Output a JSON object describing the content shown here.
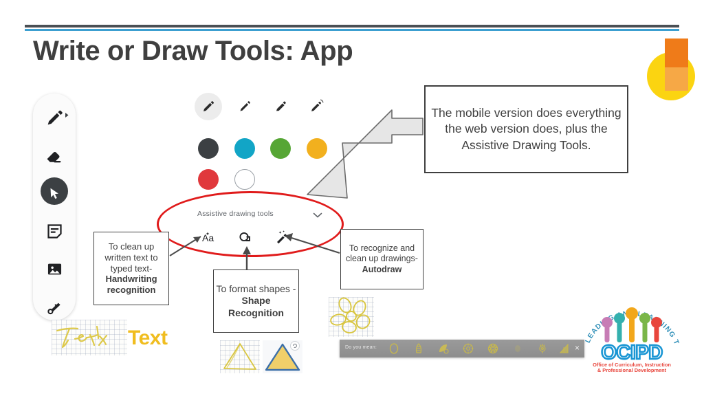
{
  "slide": {
    "title": "Write or Draw Tools: App",
    "accent_blue": "#3c9fd0",
    "accent_dark": "#4a4f54",
    "highlight_red": "#e01b1b"
  },
  "decor": {
    "circle_color": "#fbd411",
    "rect_top_color": "#ef7b19",
    "rect_bottom_color": "#f6a846"
  },
  "toolbar": {
    "items": [
      {
        "name": "pen-tool",
        "label": "Pen",
        "selected": false
      },
      {
        "name": "eraser-tool",
        "label": "Eraser",
        "selected": false
      },
      {
        "name": "select-tool",
        "label": "Select",
        "selected": true
      },
      {
        "name": "sticky-note-tool",
        "label": "Sticky note",
        "selected": false
      },
      {
        "name": "image-tool",
        "label": "Image",
        "selected": false
      },
      {
        "name": "laser-pointer-tool",
        "label": "Laser pointer",
        "selected": false
      }
    ]
  },
  "pens": {
    "items": [
      {
        "name": "pen",
        "label": "Pen",
        "selected": true
      },
      {
        "name": "marker",
        "label": "Marker",
        "selected": false
      },
      {
        "name": "highlighter",
        "label": "Highlighter",
        "selected": false
      },
      {
        "name": "thin-pen",
        "label": "Thin pen",
        "selected": false
      }
    ]
  },
  "colors": {
    "row1": [
      {
        "name": "color-black",
        "label": "Black",
        "hex": "#3c4043",
        "selected": true
      },
      {
        "name": "color-cyan",
        "label": "Cyan",
        "hex": "#12a5c6",
        "selected": false
      },
      {
        "name": "color-green",
        "label": "Green",
        "hex": "#56a635",
        "selected": false
      },
      {
        "name": "color-yellow",
        "label": "Yellow",
        "hex": "#f2b01e",
        "selected": false
      }
    ],
    "row2": [
      {
        "name": "color-red",
        "label": "Red",
        "hex": "#e0383c",
        "selected": false
      },
      {
        "name": "color-white",
        "label": "White",
        "hex": "#ffffff",
        "selected": false
      }
    ]
  },
  "assistive": {
    "panel_label": "Assistive drawing tools",
    "chevron": "chevron-down-icon",
    "tools": [
      {
        "name": "handwriting-recognition-icon",
        "label": "Aa"
      },
      {
        "name": "shape-recognition-icon",
        "label": "Shape"
      },
      {
        "name": "autodraw-icon",
        "label": "Autodraw"
      }
    ]
  },
  "callout": {
    "text": "The mobile version does everything the web version does, plus the Assistive Drawing Tools."
  },
  "notes": {
    "handwriting": {
      "lead": "To clean up written text to typed text-",
      "bold": "Handwriting recognition"
    },
    "shape": {
      "lead": "To format shapes -",
      "bold": "Shape Recognition"
    },
    "autodraw": {
      "lead": "To recognize and clean up drawings-",
      "bold": "Autodraw"
    }
  },
  "demos": {
    "handwritten_text": "Text",
    "typed_text": "Text",
    "ink_color": "#ddc94a",
    "typed_color": "#f0bd1f"
  },
  "suggest_bar": {
    "label": "Do you mean:",
    "close": "×",
    "items": [
      {
        "name": "suggestion-oval"
      },
      {
        "name": "suggestion-pinecone"
      },
      {
        "name": "suggestion-leaf"
      },
      {
        "name": "suggestion-flower"
      },
      {
        "name": "suggestion-blossom"
      },
      {
        "name": "suggestion-faint"
      },
      {
        "name": "suggestion-bud"
      },
      {
        "name": "suggestion-petal"
      }
    ]
  },
  "logo": {
    "arc_text": "LEADING AND LEARNING TOGETHER",
    "wordmark": "OCIPD",
    "tagline_line1": "Office of Curriculum, Instruction",
    "tagline_line2": "& Professional Development",
    "figure_colors": [
      "#c77cb5",
      "#34b0ae",
      "#f2a71b",
      "#7ab648",
      "#e8453c"
    ],
    "wordmark_color": "#1a96d4",
    "tagline_color": "#e8453c"
  }
}
